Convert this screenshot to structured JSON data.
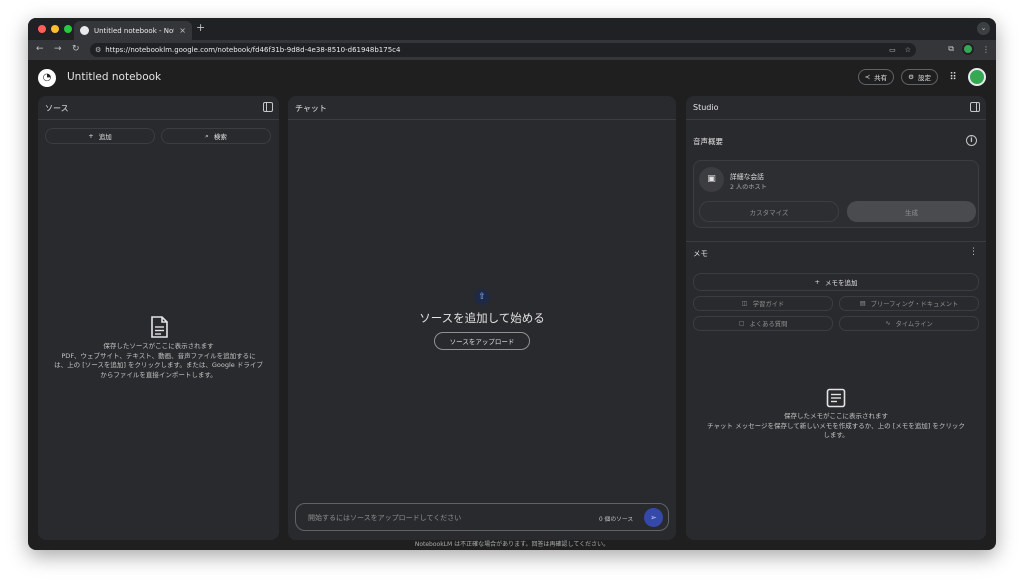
{
  "browser": {
    "tab_title": "Untitled notebook - NotebookLM",
    "tab_close": "×",
    "new_tab": "+",
    "url": "https://notebooklm.google.com/notebook/fd46f31b-9d8d-4e38-8510-d61948b175c4",
    "icons": [
      "back-icon",
      "forward-icon",
      "reload-icon",
      "site-info-icon",
      "cast-icon",
      "bookmark-star-icon",
      "extensions-icon",
      "profile-icon",
      "menu-icon"
    ],
    "colors": {
      "close": "#ff5f57",
      "minimize": "#febc2e",
      "maximize": "#28c840"
    }
  },
  "header": {
    "title": "Untitled notebook",
    "share_label": "共有",
    "settings_label": "設定"
  },
  "sources": {
    "title": "ソース",
    "add_label": "追加",
    "search_label": "検索",
    "empty_title": "保存したソースがここに表示されます",
    "empty_line1": "PDF、ウェブサイト、テキスト、動画、音声ファイルを追加するに",
    "empty_line2": "は、上の [ソースを追加] をクリックします。または、Google ドライブ",
    "empty_line3": "からファイルを直接インポートします。"
  },
  "chat": {
    "title": "チャット",
    "heading": "ソースを追加して始める",
    "upload_label": "ソースをアップロード",
    "input_placeholder": "開始するにはソースをアップロードしてください",
    "source_count": "0 個のソース"
  },
  "studio": {
    "title": "Studio",
    "audio_title": "音声概要",
    "audio_card_title": "詳細な会話",
    "audio_card_sub": "2 人のホスト",
    "customize_label": "カスタマイズ",
    "generate_label": "生成",
    "notes_title": "メモ",
    "add_note_label": "メモを追加",
    "study_guide_label": "学習ガイド",
    "briefing_label": "ブリーフィング・ドキュメント",
    "faq_label": "よくある質問",
    "timeline_label": "タイムライン",
    "notes_empty_title": "保存したメモがここに表示されます",
    "notes_empty_line1": "チャット メッセージを保存して新しいメモを作成するか、上の [メモを追加] をクリック",
    "notes_empty_line2": "します。"
  },
  "footer": "NotebookLM は不正確な場合があります。回答は再確認してください。"
}
